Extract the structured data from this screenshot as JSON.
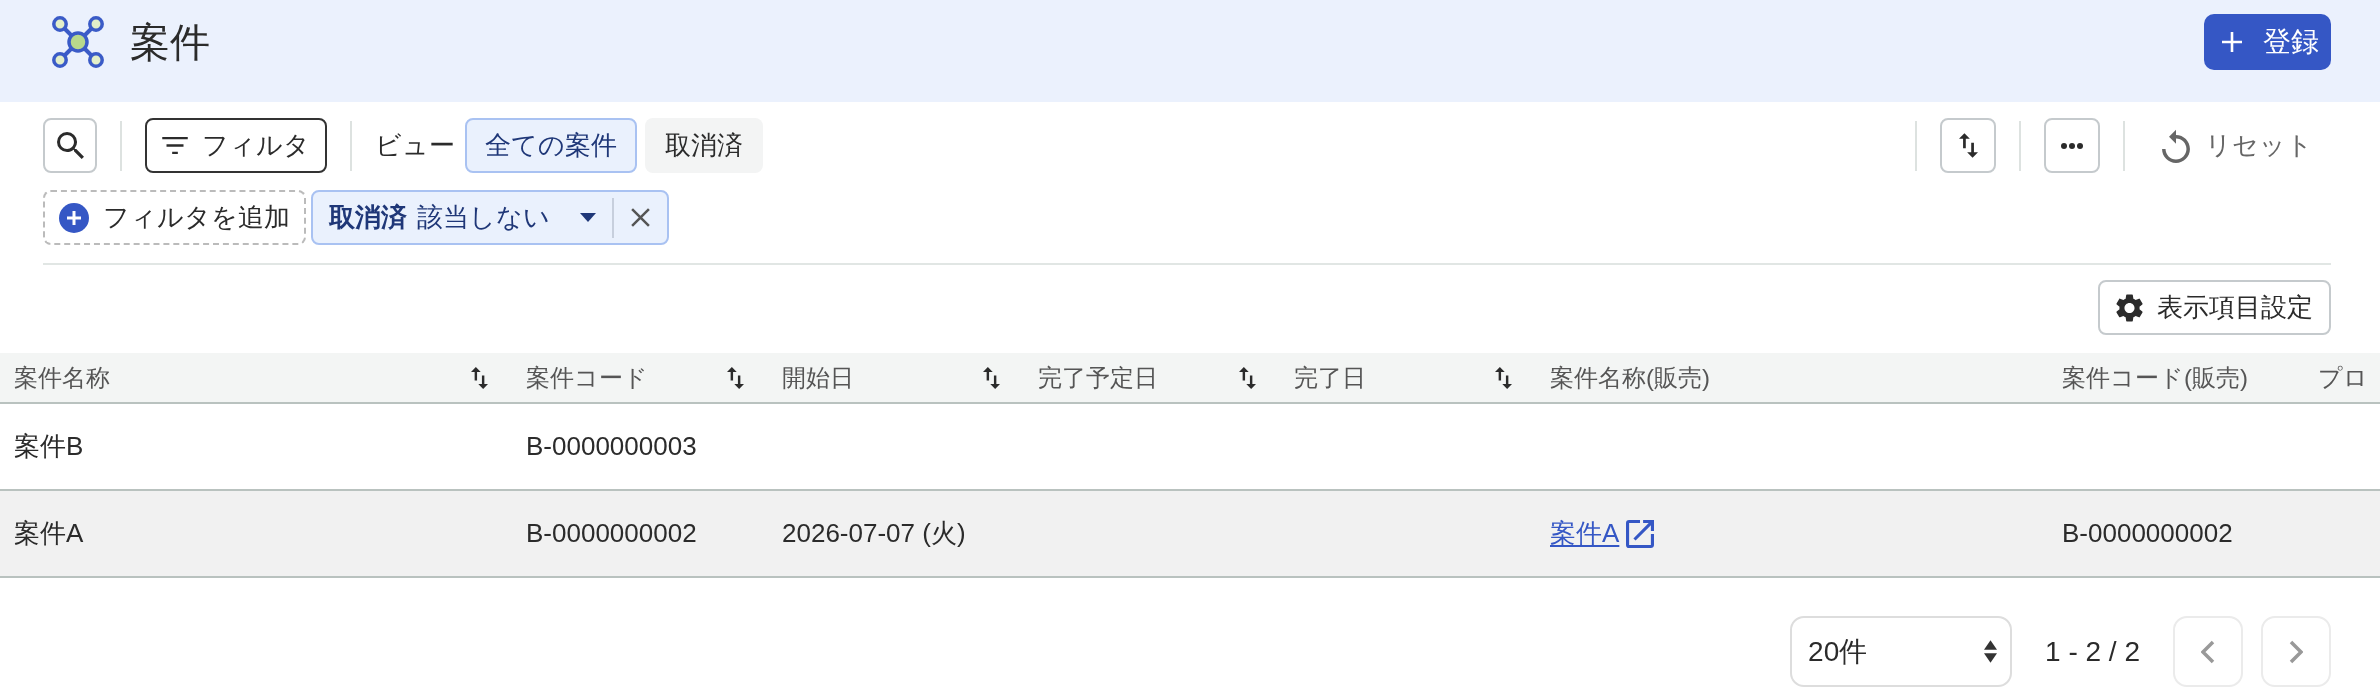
{
  "header": {
    "title": "案件",
    "register_button": {
      "label": "登録"
    }
  },
  "toolbar": {
    "filter_button": {
      "label": "フィルタ"
    },
    "view_label": "ビュー",
    "views": [
      {
        "label": "全ての案件",
        "selected": true
      },
      {
        "label": "取消済",
        "selected": false
      }
    ],
    "reset_button": {
      "label": "リセット"
    }
  },
  "filters": {
    "add_button": {
      "label": "フィルタを追加"
    },
    "chips": [
      {
        "field": "取消済",
        "value": "該当しない"
      }
    ]
  },
  "column_settings_button": {
    "label": "表示項目設定"
  },
  "table": {
    "columns": [
      {
        "label": "案件名称",
        "sortable": true
      },
      {
        "label": "案件コード",
        "sortable": true
      },
      {
        "label": "開始日",
        "sortable": true
      },
      {
        "label": "完了予定日",
        "sortable": true
      },
      {
        "label": "完了日",
        "sortable": true
      },
      {
        "label": "案件名称(販売)",
        "sortable": false
      },
      {
        "label": "案件コード(販売)",
        "sortable": false
      },
      {
        "label": "プロ",
        "sortable": false
      }
    ],
    "rows": [
      {
        "highlighted": false,
        "cells": [
          {
            "kind": "text",
            "text": "案件B"
          },
          {
            "kind": "text",
            "text": "B-0000000003"
          },
          null,
          null,
          null,
          null,
          null,
          null
        ]
      },
      {
        "highlighted": true,
        "cells": [
          {
            "kind": "text",
            "text": "案件A"
          },
          {
            "kind": "text",
            "text": "B-0000000002"
          },
          {
            "kind": "text",
            "text": "2026-07-07 (火)"
          },
          null,
          null,
          {
            "kind": "link",
            "text": "案件A"
          },
          {
            "kind": "text",
            "text": "B-0000000002"
          },
          null
        ]
      }
    ]
  },
  "pagination": {
    "page_size": "20件",
    "range": "1 - 2 / 2",
    "previous": {
      "disabled": true
    },
    "next": {
      "disabled": true
    }
  }
}
